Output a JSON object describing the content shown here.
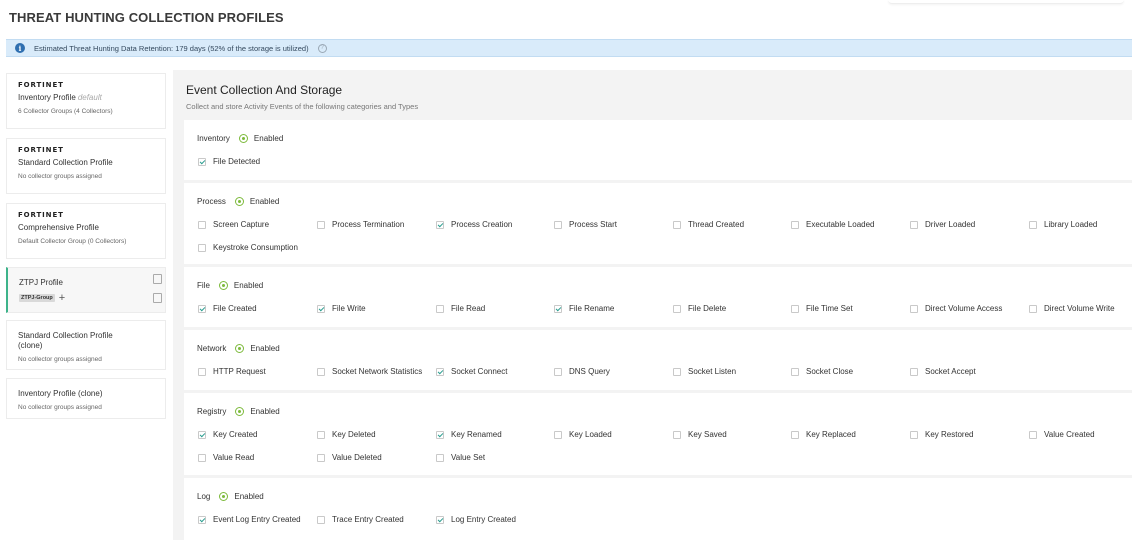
{
  "page_title": "THREAT HUNTING COLLECTION PROFILES",
  "banner": {
    "text": "Estimated Threat Hunting Data Retention: 179 days (52% of the storage is utilized)"
  },
  "brand": "FORTINET",
  "profiles": [
    {
      "brand": true,
      "name": "Inventory Profile",
      "tag": "default",
      "sub": "6 Collector Groups (4 Collectors)"
    },
    {
      "brand": true,
      "name": "Standard Collection Profile",
      "sub": "No collector groups assigned"
    },
    {
      "brand": true,
      "name": "Comprehensive Profile",
      "sub": "Default Collector Group (0 Collectors)"
    },
    {
      "name": "ZTPJ Profile",
      "group": "ZTPJ-Group",
      "selected": true
    },
    {
      "name": "Standard Collection Profile\n(clone)",
      "sub": "No collector groups assigned"
    },
    {
      "name": "Inventory Profile (clone)",
      "sub": "No collector groups assigned"
    }
  ],
  "main": {
    "title": "Event Collection And Storage",
    "subtitle": "Collect and store Activity Events of the following categories and Types",
    "enabled_label": "Enabled"
  },
  "sections": [
    {
      "name": "Inventory",
      "options": [
        {
          "label": "File Detected",
          "checked": true
        }
      ]
    },
    {
      "name": "Process",
      "options": [
        {
          "label": "Screen Capture",
          "checked": false
        },
        {
          "label": "Process Termination",
          "checked": false
        },
        {
          "label": "Process Creation",
          "checked": true
        },
        {
          "label": "Process Start",
          "checked": false
        },
        {
          "label": "Thread Created",
          "checked": false
        },
        {
          "label": "Executable Loaded",
          "checked": false
        },
        {
          "label": "Driver Loaded",
          "checked": false
        },
        {
          "label": "Library Loaded",
          "checked": false
        },
        {
          "label": "Keystroke Consumption",
          "checked": false
        }
      ]
    },
    {
      "name": "File",
      "options": [
        {
          "label": "File Created",
          "checked": true
        },
        {
          "label": "File Write",
          "checked": true
        },
        {
          "label": "File Read",
          "checked": false
        },
        {
          "label": "File Rename",
          "checked": true
        },
        {
          "label": "File Delete",
          "checked": false
        },
        {
          "label": "File Time Set",
          "checked": false
        },
        {
          "label": "Direct Volume Access",
          "checked": false
        },
        {
          "label": "Direct Volume Write",
          "checked": false
        }
      ]
    },
    {
      "name": "Network",
      "options": [
        {
          "label": "HTTP Request",
          "checked": false
        },
        {
          "label": "Socket Network Statistics",
          "checked": false
        },
        {
          "label": "Socket Connect",
          "checked": true
        },
        {
          "label": "DNS Query",
          "checked": false
        },
        {
          "label": "Socket Listen",
          "checked": false
        },
        {
          "label": "Socket Close",
          "checked": false
        },
        {
          "label": "Socket Accept",
          "checked": false
        }
      ]
    },
    {
      "name": "Registry",
      "options": [
        {
          "label": "Key Created",
          "checked": true
        },
        {
          "label": "Key Deleted",
          "checked": false
        },
        {
          "label": "Key Renamed",
          "checked": true
        },
        {
          "label": "Key Loaded",
          "checked": false
        },
        {
          "label": "Key Saved",
          "checked": false
        },
        {
          "label": "Key Replaced",
          "checked": false
        },
        {
          "label": "Key Restored",
          "checked": false
        },
        {
          "label": "Value Created",
          "checked": false
        },
        {
          "label": "Value Read",
          "checked": false
        },
        {
          "label": "Value Deleted",
          "checked": false
        },
        {
          "label": "Value Set",
          "checked": false
        }
      ]
    },
    {
      "name": "Log",
      "options": [
        {
          "label": "Event Log Entry Created",
          "checked": true
        },
        {
          "label": "Trace Entry Created",
          "checked": false
        },
        {
          "label": "Log Entry Created",
          "checked": true
        }
      ]
    }
  ]
}
